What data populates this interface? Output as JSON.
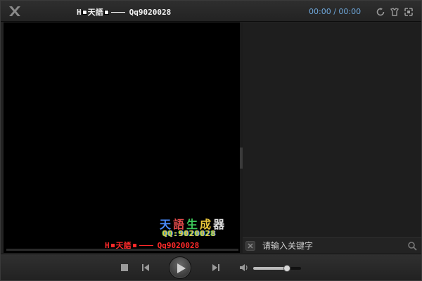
{
  "titlebar": {
    "logo_icon": "app-logo-icon",
    "title_brand": "天語",
    "title_contact": "Qq9020028",
    "time_current": "00:00",
    "time_separator": "/",
    "time_total": "00:00",
    "icons": [
      "refresh-icon",
      "skin-icon",
      "fullscreen-icon"
    ]
  },
  "video": {
    "watermark_line1": [
      "天",
      "語",
      "生",
      "成",
      "器"
    ],
    "watermark_line2": "QQ:9020028",
    "watermark_red_brand": "天語",
    "watermark_red_contact": "Qq9020028"
  },
  "playlist": {
    "search_placeholder": "请输入关键字"
  },
  "controls": {
    "icons": [
      "stop-icon",
      "previous-icon",
      "play-icon",
      "next-icon",
      "volume-icon"
    ],
    "volume_level": 0.7
  },
  "colors": {
    "time_text": "#6fa8dc",
    "background": "#232323",
    "video_bg": "#000000",
    "watermark_red": "#ff2a2a"
  }
}
